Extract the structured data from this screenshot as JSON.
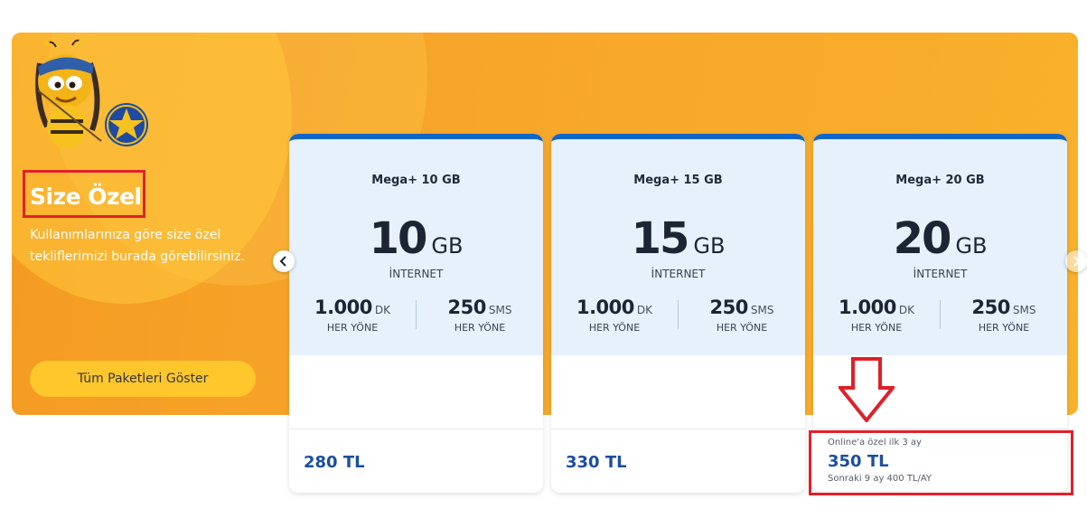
{
  "promo": {
    "title": "Size Özel",
    "subtitle": "Kullanımlarınıza göre size özel tekliflerimizi burada görebilirsiniz.",
    "show_all_label": "Tüm Paketleri Göster"
  },
  "packages": [
    {
      "name": "Mega+ 10 GB",
      "data_amount": "10",
      "data_unit": "GB",
      "data_label": "İNTERNET",
      "minutes": "1.000",
      "minutes_unit": "DK",
      "minutes_dir": "HER YÖNE",
      "sms": "250",
      "sms_unit": "SMS",
      "sms_dir": "HER YÖNE",
      "price": "280 TL"
    },
    {
      "name": "Mega+ 15 GB",
      "data_amount": "15",
      "data_unit": "GB",
      "data_label": "İNTERNET",
      "minutes": "1.000",
      "minutes_unit": "DK",
      "minutes_dir": "HER YÖNE",
      "sms": "250",
      "sms_unit": "SMS",
      "sms_dir": "HER YÖNE",
      "price": "330 TL"
    },
    {
      "name": "Mega+ 20 GB",
      "data_amount": "20",
      "data_unit": "GB",
      "data_label": "İNTERNET",
      "minutes": "1.000",
      "minutes_unit": "DK",
      "minutes_dir": "HER YÖNE",
      "sms": "250",
      "sms_unit": "SMS",
      "sms_dir": "HER YÖNE",
      "promo_note": "Online'a özel ilk 3 ay",
      "price": "350 TL",
      "price_next": "Sonraki 9 ay 400 TL/AY"
    }
  ],
  "icons": {
    "prev": "chevron-left-icon",
    "next": "chevron-right-icon",
    "mascot": "bee-mascot-icon",
    "star": "star-badge-icon",
    "annotation_arrow": "down-arrow-icon"
  },
  "colors": {
    "banner": "#f7a52a",
    "accent_blue": "#1166c6",
    "price_blue": "#1c4ea0",
    "button_yellow": "#ffc72c",
    "annotation_red": "#e0202a"
  }
}
